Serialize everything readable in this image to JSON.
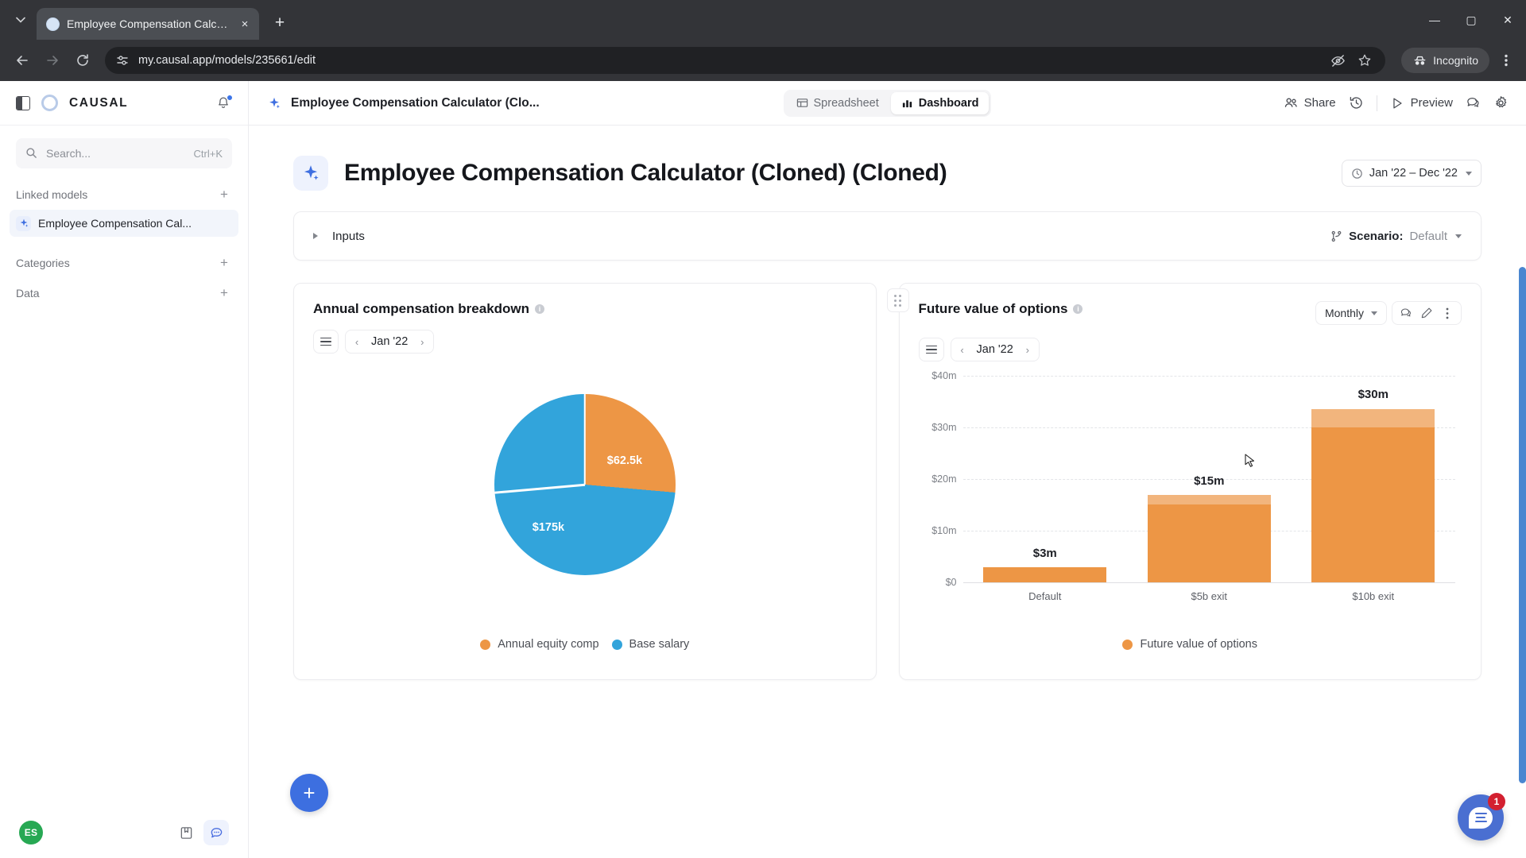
{
  "browser": {
    "tab": {
      "title": "Employee Compensation Calcu...",
      "favicon": "page-icon",
      "close": "×"
    },
    "newtab_label": "+",
    "tab_search": "chevron-down-icon",
    "window": {
      "minimize": "—",
      "maximize": "▢",
      "close": "✕"
    },
    "url": "my.causal.app/models/235661/edit",
    "incognito_label": "Incognito",
    "icons": {
      "back": "back-arrow-icon",
      "forward": "forward-arrow-icon",
      "reload": "reload-icon",
      "site_settings": "site-settings-icon",
      "tracking": "eye-off-icon",
      "bookmark": "star-icon",
      "menu": "kebab-menu-icon"
    }
  },
  "sidebar": {
    "logo_text": "CAUSAL",
    "panel_toggle": "panel-toggle-icon",
    "notifications": "bell-icon",
    "search": {
      "placeholder": "Search...",
      "shortcut": "Ctrl+K"
    },
    "sections": [
      {
        "title": "Linked models",
        "add": "+"
      },
      {
        "title": "Categories",
        "add": "+"
      },
      {
        "title": "Data",
        "add": "+"
      }
    ],
    "linked_models": [
      {
        "label": "Employee Compensation Cal..."
      }
    ],
    "footer": {
      "avatar_initials": "ES",
      "buttons": [
        "book-icon",
        "chat-icon"
      ]
    }
  },
  "topbar": {
    "breadcrumb": "Employee Compensation Calculator (Clo...",
    "tabs": [
      {
        "label": "Spreadsheet",
        "icon": "table-icon",
        "active": false
      },
      {
        "label": "Dashboard",
        "icon": "bar-chart-icon",
        "active": true
      }
    ],
    "share_label": "Share",
    "preview_label": "Preview",
    "icons": {
      "share": "people-icon",
      "history": "history-icon",
      "preview": "play-icon",
      "comments": "comment-icon",
      "settings": "gear-icon"
    }
  },
  "page": {
    "title": "Employee Compensation Calculator (Cloned) (Cloned)",
    "doc_icon": "sparkle-icon",
    "date_range": {
      "label": "Jan '22 – Dec '22",
      "icon": "clock-icon"
    },
    "inputs": {
      "label": "Inputs",
      "expander": "chevron-right-icon"
    },
    "scenario": {
      "key": "Scenario:",
      "value": "Default",
      "icon": "branch-icon"
    }
  },
  "cards": [
    {
      "title": "Annual compensation breakdown",
      "info": "i",
      "period": {
        "label": "Jan '22",
        "prev": "‹",
        "next": "›",
        "menu": "hamburger-icon"
      }
    },
    {
      "title": "Future value of options",
      "info": "i",
      "granularity": "Monthly",
      "period": {
        "label": "Jan '22",
        "prev": "‹",
        "next": "›",
        "menu": "hamburger-icon"
      },
      "actions": [
        "comment-icon",
        "edit-pencil-icon",
        "more-vertical-icon"
      ],
      "drag": "drag-handle-icon"
    }
  ],
  "chart_data": [
    {
      "type": "pie",
      "title": "Annual compensation breakdown",
      "period": "Jan '22",
      "labels": [
        "Annual equity comp",
        "Base salary"
      ],
      "values": [
        62500,
        175000
      ],
      "display_labels": [
        "$62.5k",
        "$175k"
      ],
      "colors": [
        "#ed9645",
        "#32a4db"
      ],
      "legend_position": "bottom",
      "start_angle_deg": 0,
      "slice_sweeps_deg": [
        95,
        265
      ]
    },
    {
      "type": "bar",
      "title": "Future value of options",
      "period": "Jan '22",
      "granularity": "Monthly",
      "categories": [
        "Default",
        "$5b exit",
        "$10b exit"
      ],
      "values": [
        3,
        15,
        30
      ],
      "display_labels": [
        "$3m",
        "$15m",
        "$30m"
      ],
      "series": [
        {
          "name": "Future value of options",
          "values": [
            3,
            15,
            30
          ]
        }
      ],
      "ylabel": "",
      "xlabel": "",
      "ylim": [
        0,
        40
      ],
      "yticks": [
        0,
        10,
        20,
        30,
        40
      ],
      "ytick_labels": [
        "$0",
        "$10m",
        "$20m",
        "$30m",
        "$40m"
      ],
      "unit": "m",
      "grid": true,
      "colors": [
        "#ed9645"
      ],
      "cap_color": "#f2b57d",
      "legend_position": "bottom",
      "legend": [
        "Future value of options"
      ]
    }
  ],
  "floating": {
    "add_button": "+",
    "chat": {
      "badge": "1",
      "icon": "chat-bubble-icon"
    }
  }
}
